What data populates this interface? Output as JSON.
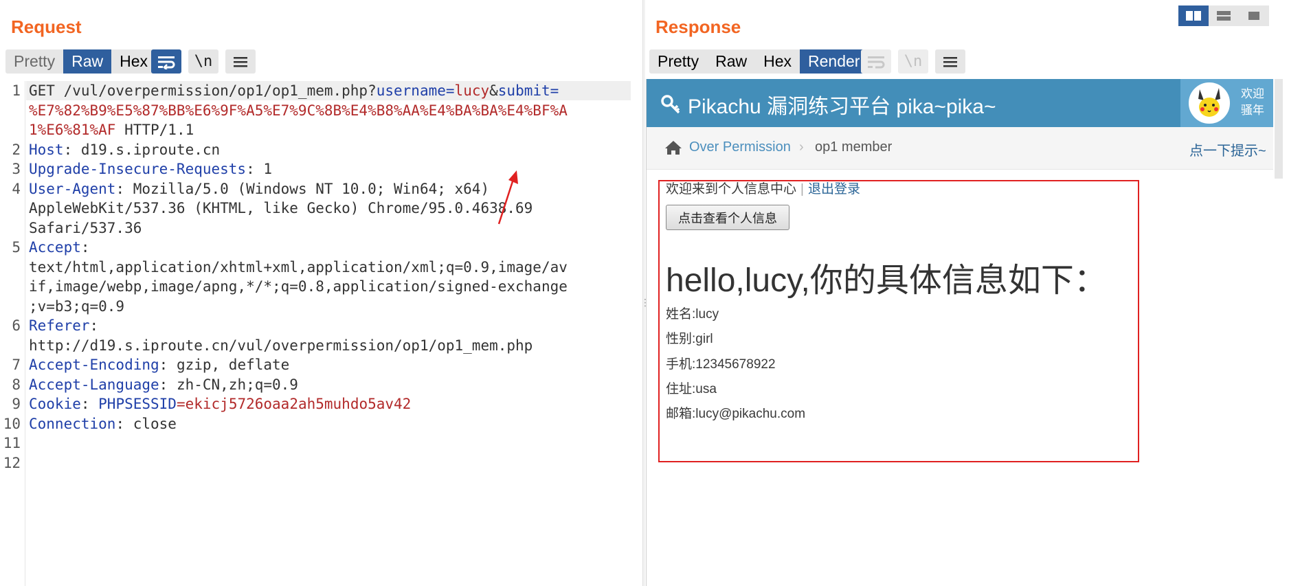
{
  "request": {
    "title": "Request",
    "tabs": [
      {
        "label": "Pretty",
        "active": false
      },
      {
        "label": "Raw",
        "active": true
      },
      {
        "label": "Hex",
        "active": false
      }
    ],
    "newline_toggle": "\\n",
    "icons": [
      "wrap-lines-icon",
      "newline-icon",
      "menu-icon"
    ],
    "line_numbers": [
      "1",
      "2",
      "3",
      "4",
      "5",
      "6",
      "7",
      "8",
      "9",
      "10",
      "11",
      "12"
    ],
    "lines": {
      "l1_method": "GET /vul/overpermission/op1/op1_mem.php?",
      "l1_k1": "username",
      "l1_eq1": "=",
      "l1_v1": "lucy",
      "l1_amp": "&",
      "l1_k2": "submit",
      "l1_eq2": "=",
      "l1_v2a": "%E7%82%B9%E5%87%BB%E6%9F%A5%E7%9C%8B%E4%B8%AA%E4%BA%BA%E4%BF%A",
      "l1_v2b": "1%E6%81%AF",
      "l1_proto": " HTTP/1.1",
      "l2_k": "Host",
      "l2_v": ": d19.s.iproute.cn",
      "l3_k": "Upgrade-Insecure-Requests",
      "l3_v": ": 1",
      "l4_k": "User-Agent",
      "l4_v": ": Mozilla/5.0 (Windows NT 10.0; Win64; x64)",
      "l4_c1": "AppleWebKit/537.36 (KHTML, like Gecko) Chrome/95.0.4638.69",
      "l4_c2": "Safari/537.36",
      "l5_k": "Accept",
      "l5_v": ":",
      "l5_c1": "text/html,application/xhtml+xml,application/xml;q=0.9,image/av",
      "l5_c2": "if,image/webp,image/apng,*/*;q=0.8,application/signed-exchange",
      "l5_c3": ";v=b3;q=0.9",
      "l6_k": "Referer",
      "l6_v": ":",
      "l6_c1": "http://d19.s.iproute.cn/vul/overpermission/op1/op1_mem.php",
      "l7_k": "Accept-Encoding",
      "l7_v": ": gzip, deflate",
      "l8_k": "Accept-Language",
      "l8_v": ": zh-CN,zh;q=0.9",
      "l9_k": "Cookie",
      "l9_sep": ": ",
      "l9_ck": "PHPSESSID",
      "l9_eq": "=",
      "l9_cv": "ekicj5726oaa2ah5muhdo5av42",
      "l10_k": "Connection",
      "l10_v": ": close"
    }
  },
  "response": {
    "title": "Response",
    "tabs": [
      {
        "label": "Pretty",
        "active": false
      },
      {
        "label": "Raw",
        "active": false
      },
      {
        "label": "Hex",
        "active": false
      },
      {
        "label": "Render",
        "active": true
      }
    ],
    "newline_toggle": "\\n",
    "page": {
      "brand": "Pikachu 漏洞练习平台 pika~pika~",
      "welcome_line1": "欢迎",
      "welcome_line2": "骚年",
      "breadcrumb_link": "Over Permission",
      "breadcrumb_sep": "›",
      "breadcrumb_current": "op1 member",
      "hint": "点一下提示~",
      "welcome_text": "欢迎来到个人信息中心",
      "welcome_sep": "|",
      "logout": "退出登录",
      "view_button": "点击查看个人信息",
      "hello": "hello,lucy,你的具体信息如下：",
      "info": [
        "姓名:lucy",
        "性别:girl",
        "手机:12345678922",
        "住址:usa",
        "邮箱:lucy@pikachu.com"
      ]
    }
  },
  "layout_toggles": [
    "split-vertical-icon",
    "split-horizontal-icon",
    "single-pane-icon"
  ],
  "colors": {
    "accent_orange": "#f26522",
    "active_tab": "#2f5f9e",
    "header_key": "#1f3fa8",
    "header_value": "#b22a2a",
    "pikachu_bar": "#438eb9",
    "annotation_red": "#e02020"
  }
}
